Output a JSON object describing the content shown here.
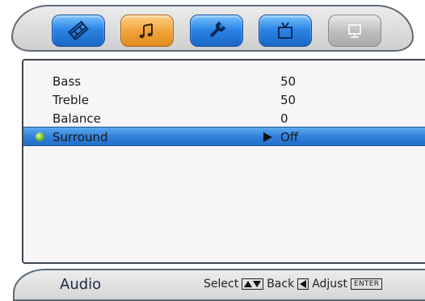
{
  "tabs": [
    {
      "icon": "film-reel-icon",
      "state": "normal"
    },
    {
      "icon": "music-note-icon",
      "state": "active"
    },
    {
      "icon": "wrench-icon",
      "state": "normal"
    },
    {
      "icon": "tv-icon",
      "state": "normal"
    },
    {
      "icon": "monitor-icon",
      "state": "disabled"
    }
  ],
  "settings": [
    {
      "label": "Bass",
      "value": "50"
    },
    {
      "label": "Treble",
      "value": "50"
    },
    {
      "label": "Balance",
      "value": "0"
    },
    {
      "label": "Surround",
      "value": "Off",
      "selected": true
    }
  ],
  "footer": {
    "menu_title": "Audio",
    "select_label": "Select",
    "back_label": "Back",
    "adjust_label": "Adjust",
    "enter_key": "ENTER"
  },
  "colors": {
    "tab_blue": "#2b86e6",
    "tab_active_orange": "#f2a33c",
    "tab_disabled_gray": "#bdbdbd",
    "selection_blue": "#2f7fda",
    "indicator_green": "#6fbf2a"
  }
}
